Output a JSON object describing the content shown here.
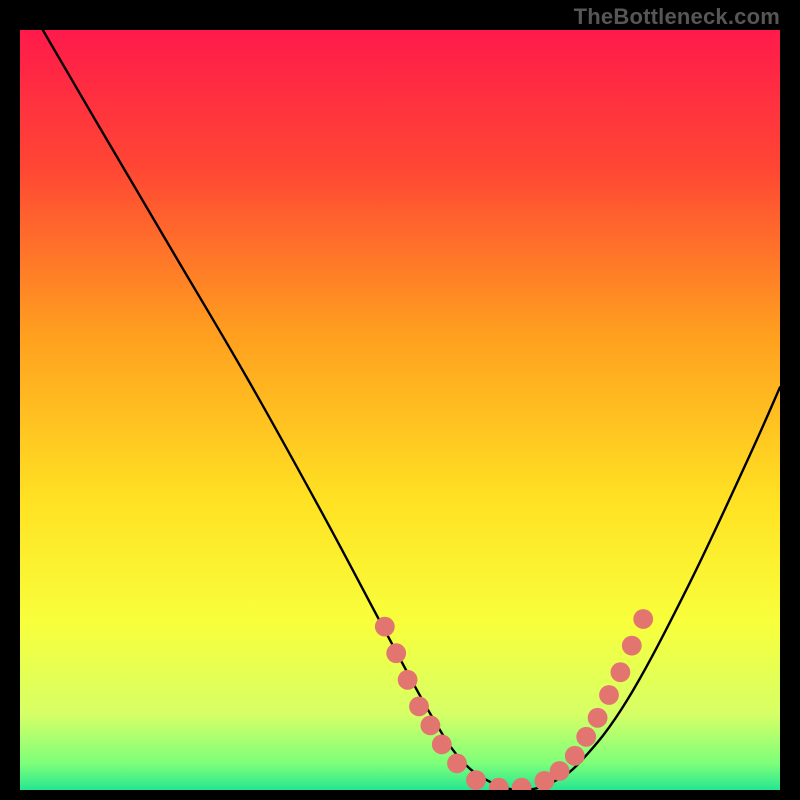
{
  "watermark": "TheBottleneck.com",
  "chart_data": {
    "type": "line",
    "title": "",
    "xlabel": "",
    "ylabel": "",
    "xlim": [
      0,
      100
    ],
    "ylim": [
      0,
      100
    ],
    "gradient_stops": [
      {
        "offset": 0.0,
        "color": "#ff1a4b"
      },
      {
        "offset": 0.18,
        "color": "#ff4634"
      },
      {
        "offset": 0.4,
        "color": "#ff9f1f"
      },
      {
        "offset": 0.62,
        "color": "#ffe223"
      },
      {
        "offset": 0.78,
        "color": "#f8ff3c"
      },
      {
        "offset": 0.9,
        "color": "#d6ff66"
      },
      {
        "offset": 0.965,
        "color": "#7dff7a"
      },
      {
        "offset": 1.0,
        "color": "#26e691"
      }
    ],
    "series": [
      {
        "name": "bottleneck-curve",
        "x": [
          3,
          10,
          20,
          30,
          40,
          48,
          54,
          58,
          62,
          66,
          70,
          74,
          80,
          88,
          96,
          100
        ],
        "y": [
          100,
          88,
          71,
          54,
          36,
          21,
          10,
          4,
          1,
          0,
          1,
          4,
          12,
          27,
          44,
          53
        ]
      }
    ],
    "dots": {
      "name": "highlighted-points",
      "color": "#e2756f",
      "radius_pct": 1.3,
      "points": [
        {
          "x": 48.0,
          "y": 21.5
        },
        {
          "x": 49.5,
          "y": 18.0
        },
        {
          "x": 51.0,
          "y": 14.5
        },
        {
          "x": 52.5,
          "y": 11.0
        },
        {
          "x": 54.0,
          "y": 8.5
        },
        {
          "x": 55.5,
          "y": 6.0
        },
        {
          "x": 57.5,
          "y": 3.5
        },
        {
          "x": 60.0,
          "y": 1.3
        },
        {
          "x": 63.0,
          "y": 0.3
        },
        {
          "x": 66.0,
          "y": 0.3
        },
        {
          "x": 69.0,
          "y": 1.2
        },
        {
          "x": 71.0,
          "y": 2.5
        },
        {
          "x": 73.0,
          "y": 4.5
        },
        {
          "x": 74.5,
          "y": 7.0
        },
        {
          "x": 76.0,
          "y": 9.5
        },
        {
          "x": 77.5,
          "y": 12.5
        },
        {
          "x": 79.0,
          "y": 15.5
        },
        {
          "x": 80.5,
          "y": 19.0
        },
        {
          "x": 82.0,
          "y": 22.5
        }
      ]
    }
  }
}
